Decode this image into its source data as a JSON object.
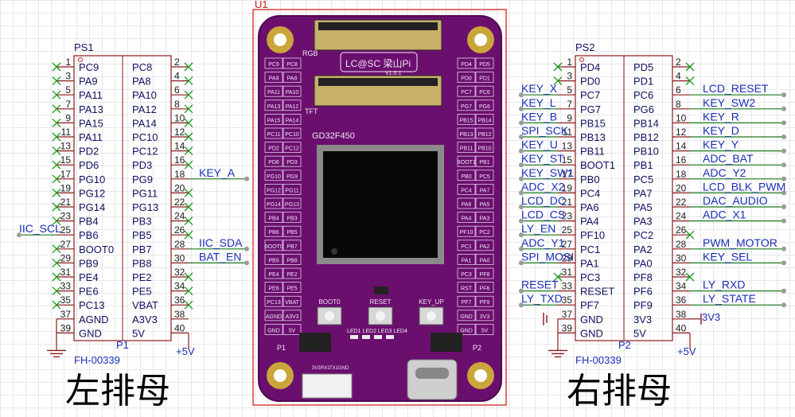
{
  "left_header": {
    "ref": "PS1",
    "part_label": "P1",
    "footprint": "FH-00339",
    "supply": "+5V",
    "caption": "左排母",
    "pins": [
      {
        "num": "1",
        "name": "PC9"
      },
      {
        "num": "2",
        "name": "PC8"
      },
      {
        "num": "3",
        "name": "PA9"
      },
      {
        "num": "4",
        "name": "PA8"
      },
      {
        "num": "5",
        "name": "PA11"
      },
      {
        "num": "6",
        "name": "PA10"
      },
      {
        "num": "7",
        "name": "PA13"
      },
      {
        "num": "8",
        "name": "PA12"
      },
      {
        "num": "9",
        "name": "PA15"
      },
      {
        "num": "10",
        "name": "PA14"
      },
      {
        "num": "11",
        "name": "PA11"
      },
      {
        "num": "12",
        "name": "PC10"
      },
      {
        "num": "13",
        "name": "PD2"
      },
      {
        "num": "14",
        "name": "PC12"
      },
      {
        "num": "15",
        "name": "PD6"
      },
      {
        "num": "16",
        "name": "PD3"
      },
      {
        "num": "17",
        "name": "PG10"
      },
      {
        "num": "18",
        "name": "PG9"
      },
      {
        "num": "19",
        "name": "PG12"
      },
      {
        "num": "20",
        "name": "PG11"
      },
      {
        "num": "21",
        "name": "PG14"
      },
      {
        "num": "22",
        "name": "PG13"
      },
      {
        "num": "23",
        "name": "PB4"
      },
      {
        "num": "24",
        "name": "PB3"
      },
      {
        "num": "25",
        "name": "PB6"
      },
      {
        "num": "26",
        "name": "PB5"
      },
      {
        "num": "27",
        "name": "BOOT0"
      },
      {
        "num": "28",
        "name": "PB7"
      },
      {
        "num": "29",
        "name": "PB9"
      },
      {
        "num": "30",
        "name": "PB8"
      },
      {
        "num": "31",
        "name": "PE4"
      },
      {
        "num": "32",
        "name": "PE2"
      },
      {
        "num": "33",
        "name": "PE6"
      },
      {
        "num": "34",
        "name": "PE5"
      },
      {
        "num": "35",
        "name": "PC13"
      },
      {
        "num": "36",
        "name": "VBAT"
      },
      {
        "num": "37",
        "name": "AGND"
      },
      {
        "num": "38",
        "name": "A3V3"
      },
      {
        "num": "39",
        "name": "GND"
      },
      {
        "num": "40",
        "name": "5V"
      }
    ],
    "nets": [
      {
        "pin": "18",
        "label": "KEY_A"
      },
      {
        "pin": "25",
        "label": "IIC_SCL"
      },
      {
        "pin": "28",
        "label": "IIC_SDA"
      },
      {
        "pin": "30",
        "label": "BAT_EN"
      }
    ]
  },
  "right_header": {
    "ref": "PS2",
    "part_label": "P2",
    "footprint": "FH-00339",
    "supply": "+5V",
    "net_3v3": "3V3",
    "caption": "右排母",
    "pins": [
      {
        "num": "1",
        "name": "PD4"
      },
      {
        "num": "2",
        "name": "PD5"
      },
      {
        "num": "3",
        "name": "PD0"
      },
      {
        "num": "4",
        "name": "PD1"
      },
      {
        "num": "5",
        "name": "PC7"
      },
      {
        "num": "6",
        "name": "PC6"
      },
      {
        "num": "7",
        "name": "PG7"
      },
      {
        "num": "8",
        "name": "PG6"
      },
      {
        "num": "9",
        "name": "PB15"
      },
      {
        "num": "10",
        "name": "PB14"
      },
      {
        "num": "11",
        "name": "PB13"
      },
      {
        "num": "12",
        "name": "PB12"
      },
      {
        "num": "13",
        "name": "PB11"
      },
      {
        "num": "14",
        "name": "PB10"
      },
      {
        "num": "15",
        "name": "BOOT1"
      },
      {
        "num": "16",
        "name": "PB1"
      },
      {
        "num": "17",
        "name": "PB0"
      },
      {
        "num": "18",
        "name": "PC5"
      },
      {
        "num": "19",
        "name": "PC4"
      },
      {
        "num": "20",
        "name": "PA7"
      },
      {
        "num": "21",
        "name": "PA6"
      },
      {
        "num": "22",
        "name": "PA5"
      },
      {
        "num": "23",
        "name": "PA4"
      },
      {
        "num": "24",
        "name": "PA3"
      },
      {
        "num": "25",
        "name": "PF10"
      },
      {
        "num": "26",
        "name": "PC2"
      },
      {
        "num": "27",
        "name": "PC1"
      },
      {
        "num": "28",
        "name": "PA2"
      },
      {
        "num": "29",
        "name": "PA1"
      },
      {
        "num": "30",
        "name": "PA0"
      },
      {
        "num": "31",
        "name": "PC3"
      },
      {
        "num": "32",
        "name": "PF8"
      },
      {
        "num": "33",
        "name": "RESET"
      },
      {
        "num": "34",
        "name": "PF6"
      },
      {
        "num": "35",
        "name": "PF7"
      },
      {
        "num": "36",
        "name": "PF9"
      },
      {
        "num": "37",
        "name": "GND"
      },
      {
        "num": "38",
        "name": "3V3"
      },
      {
        "num": "39",
        "name": "GND"
      },
      {
        "num": "40",
        "name": "5V"
      }
    ],
    "nets_left": [
      {
        "pin": "5",
        "label": "KEY_X"
      },
      {
        "pin": "7",
        "label": "KEY_L"
      },
      {
        "pin": "9",
        "label": "KEY_B"
      },
      {
        "pin": "11",
        "label": "SPI_SCK"
      },
      {
        "pin": "13",
        "label": "KEY_U"
      },
      {
        "pin": "15",
        "label": "KEY_ST"
      },
      {
        "pin": "17",
        "label": "KEY_SW1"
      },
      {
        "pin": "19",
        "label": "ADC_X2"
      },
      {
        "pin": "21",
        "label": "LCD_DC"
      },
      {
        "pin": "23",
        "label": "LCD_CS"
      },
      {
        "pin": "25",
        "label": "LY_EN"
      },
      {
        "pin": "27",
        "label": "ADC_Y1"
      },
      {
        "pin": "29",
        "label": "SPI_MOSI"
      },
      {
        "pin": "33",
        "label": "RESET"
      },
      {
        "pin": "35",
        "label": "LY_TXD"
      }
    ],
    "nets_right": [
      {
        "pin": "6",
        "label": "LCD_RESET"
      },
      {
        "pin": "8",
        "label": "KEY_SW2"
      },
      {
        "pin": "10",
        "label": "KEY_R"
      },
      {
        "pin": "12",
        "label": "KEY_D"
      },
      {
        "pin": "14",
        "label": "KEY_Y"
      },
      {
        "pin": "16",
        "label": "ADC_BAT"
      },
      {
        "pin": "18",
        "label": "ADC_Y2"
      },
      {
        "pin": "20",
        "label": "LCD_BLK_PWM"
      },
      {
        "pin": "22",
        "label": "DAC_AUDIO"
      },
      {
        "pin": "24",
        "label": "ADC_X1"
      },
      {
        "pin": "28",
        "label": "PWM_MOTOR"
      },
      {
        "pin": "30",
        "label": "KEY_SEL"
      },
      {
        "pin": "34",
        "label": "LY_RXD"
      },
      {
        "pin": "36",
        "label": "LY_STATE"
      }
    ]
  },
  "board": {
    "ref": "U1",
    "rgb_label": "RGB",
    "tft_label": "TFT",
    "logo": "LC@SC 梁山Pi",
    "version": "V1.0.1",
    "chip": "GD32F450",
    "buttons": [
      "BOOT0",
      "RESET",
      "KEY_UP"
    ],
    "leds": "LED1 LED2 LED3 LED4",
    "p1_label": "P1",
    "p2_label": "P2",
    "left_col_a": [
      "PC9",
      "PA9",
      "PA11",
      "PA13",
      "PA15",
      "PC11",
      "PD2",
      "PD6",
      "PG10",
      "PG12",
      "PG14",
      "PB4",
      "PB6",
      "BOOT0",
      "PB9",
      "PE4",
      "PE6",
      "PC13",
      "AGND",
      "GND"
    ],
    "left_col_b": [
      "PC8",
      "PA8",
      "PA10",
      "PA12",
      "PA14",
      "PC10",
      "PC12",
      "PD3",
      "PG9",
      "PG11",
      "PG13",
      "PB3",
      "PB5",
      "PB7",
      "PB8",
      "PE2",
      "PE5",
      "VBAT",
      "A3V3",
      "5V"
    ],
    "right_col_a": [
      "PD4",
      "PD0",
      "PC7",
      "PG7",
      "PB15",
      "PB13",
      "PB11",
      "BOOT1",
      "PB0",
      "PC4",
      "PA6",
      "PA4",
      "PF10",
      "PC1",
      "PA1",
      "PC3",
      "RST",
      "PF7",
      "GND",
      "GND"
    ],
    "right_col_b": [
      "PD5",
      "PD1",
      "PC6",
      "PG6",
      "PB14",
      "PB12",
      "PB10",
      "PB1",
      "PC5",
      "PA7",
      "PA5",
      "PA3",
      "PC2",
      "PA2",
      "PA0",
      "PF8",
      "PF6",
      "PF9",
      "3V3",
      "5V"
    ],
    "bottom_silk": [
      "3V3",
      "RX1",
      "TX1",
      "GND"
    ]
  },
  "colors": {
    "board": "#6b0f6e",
    "board_edge": "#4d0a50",
    "silk": "#f0e6f5",
    "net": "#1a2fb8",
    "wire": "#1a7a1a",
    "outline": "#8b1a1a",
    "noconnect": "#1a9a1a"
  }
}
